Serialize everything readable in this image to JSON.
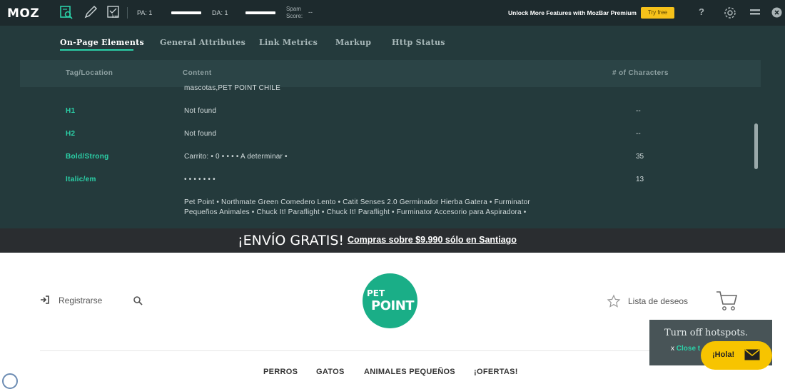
{
  "mozbar": {
    "logo": "MOZ",
    "pa_label": "PA: 1",
    "da_label": "DA: 1",
    "spam_label_1": "Spam",
    "spam_label_2": "Score:",
    "spam_value": "--",
    "unlock_text": "Unlock More Features with MozBar Premium",
    "try_free": "Try free",
    "help": "?",
    "icons": [
      "page-analysis-icon",
      "highlight-pencil-icon",
      "keyword-icon",
      "gear-icon",
      "minimize-icon",
      "close-icon"
    ]
  },
  "panel": {
    "tabs": [
      {
        "label": "On-Page Elements",
        "active": true
      },
      {
        "label": "General Attributes"
      },
      {
        "label": "Link Metrics"
      },
      {
        "label": "Markup"
      },
      {
        "label": "Http Status"
      }
    ],
    "columns": [
      "Tag/Location",
      "Content",
      "# of Characters"
    ],
    "overflow_text": "mascotas,PET POINT CHILE",
    "rows": [
      {
        "tag": "H1",
        "content": "Not found",
        "count": "--"
      },
      {
        "tag": "H2",
        "content": "Not found",
        "count": "--"
      },
      {
        "tag": "Bold/Strong",
        "content": "Carrito: • 0 • • • • A determinar •",
        "count": "35"
      },
      {
        "tag": "Italic/em",
        "content": "• • • • • • •",
        "count": "13"
      }
    ],
    "alt_lines": [
      "Pet Point • Northmate Green Comedero Lento • Catit Senses 2.0 Germinador Hierba Gatera • Furminator",
      "Pequeños Animales • Chuck It! Paraflight • Chuck It! Paraflight • Furminator Accesorio para Aspiradora •"
    ]
  },
  "banner": {
    "title": "¡ENVÍO GRATIS!",
    "link": "Compras sobre $9.990 sólo en Santiago"
  },
  "store": {
    "register": "Registrarse",
    "logo_top": "PET",
    "logo_bottom": "POINT",
    "wishlist": "Lista de deseos",
    "nav": [
      "PERROS",
      "GATOS",
      "ANIMALES PEQUEÑOS",
      "¡OFERTAS!"
    ]
  },
  "hotspot": {
    "title": "Turn off hotspots.",
    "close_x": "x",
    "close_label": "Close t"
  },
  "chat": {
    "label": "¡Hola!"
  },
  "colors": {
    "accent": "#2bd1a8",
    "brand_green": "#1aae87",
    "try_free": "#f6c21a",
    "chat_yellow": "#f7c400"
  }
}
